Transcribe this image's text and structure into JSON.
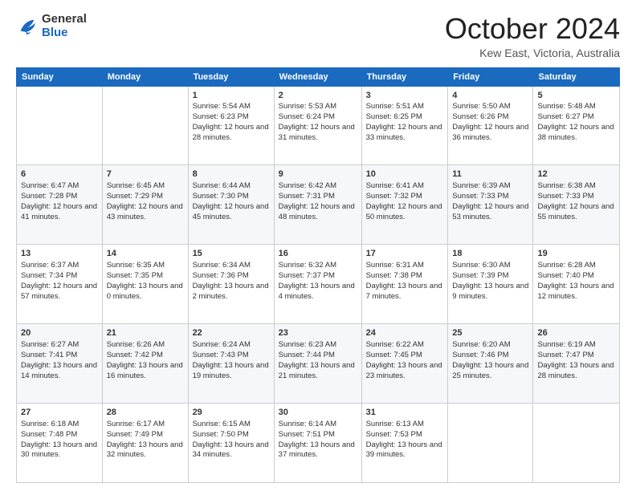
{
  "logo": {
    "general": "General",
    "blue": "Blue"
  },
  "header": {
    "month_year": "October 2024",
    "location": "Kew East, Victoria, Australia"
  },
  "days_of_week": [
    "Sunday",
    "Monday",
    "Tuesday",
    "Wednesday",
    "Thursday",
    "Friday",
    "Saturday"
  ],
  "weeks": [
    [
      {
        "day": "",
        "info": ""
      },
      {
        "day": "",
        "info": ""
      },
      {
        "day": "1",
        "info": "Sunrise: 5:54 AM\nSunset: 6:23 PM\nDaylight: 12 hours and 28 minutes."
      },
      {
        "day": "2",
        "info": "Sunrise: 5:53 AM\nSunset: 6:24 PM\nDaylight: 12 hours and 31 minutes."
      },
      {
        "day": "3",
        "info": "Sunrise: 5:51 AM\nSunset: 6:25 PM\nDaylight: 12 hours and 33 minutes."
      },
      {
        "day": "4",
        "info": "Sunrise: 5:50 AM\nSunset: 6:26 PM\nDaylight: 12 hours and 36 minutes."
      },
      {
        "day": "5",
        "info": "Sunrise: 5:48 AM\nSunset: 6:27 PM\nDaylight: 12 hours and 38 minutes."
      }
    ],
    [
      {
        "day": "6",
        "info": "Sunrise: 6:47 AM\nSunset: 7:28 PM\nDaylight: 12 hours and 41 minutes."
      },
      {
        "day": "7",
        "info": "Sunrise: 6:45 AM\nSunset: 7:29 PM\nDaylight: 12 hours and 43 minutes."
      },
      {
        "day": "8",
        "info": "Sunrise: 6:44 AM\nSunset: 7:30 PM\nDaylight: 12 hours and 45 minutes."
      },
      {
        "day": "9",
        "info": "Sunrise: 6:42 AM\nSunset: 7:31 PM\nDaylight: 12 hours and 48 minutes."
      },
      {
        "day": "10",
        "info": "Sunrise: 6:41 AM\nSunset: 7:32 PM\nDaylight: 12 hours and 50 minutes."
      },
      {
        "day": "11",
        "info": "Sunrise: 6:39 AM\nSunset: 7:33 PM\nDaylight: 12 hours and 53 minutes."
      },
      {
        "day": "12",
        "info": "Sunrise: 6:38 AM\nSunset: 7:33 PM\nDaylight: 12 hours and 55 minutes."
      }
    ],
    [
      {
        "day": "13",
        "info": "Sunrise: 6:37 AM\nSunset: 7:34 PM\nDaylight: 12 hours and 57 minutes."
      },
      {
        "day": "14",
        "info": "Sunrise: 6:35 AM\nSunset: 7:35 PM\nDaylight: 13 hours and 0 minutes."
      },
      {
        "day": "15",
        "info": "Sunrise: 6:34 AM\nSunset: 7:36 PM\nDaylight: 13 hours and 2 minutes."
      },
      {
        "day": "16",
        "info": "Sunrise: 6:32 AM\nSunset: 7:37 PM\nDaylight: 13 hours and 4 minutes."
      },
      {
        "day": "17",
        "info": "Sunrise: 6:31 AM\nSunset: 7:38 PM\nDaylight: 13 hours and 7 minutes."
      },
      {
        "day": "18",
        "info": "Sunrise: 6:30 AM\nSunset: 7:39 PM\nDaylight: 13 hours and 9 minutes."
      },
      {
        "day": "19",
        "info": "Sunrise: 6:28 AM\nSunset: 7:40 PM\nDaylight: 13 hours and 12 minutes."
      }
    ],
    [
      {
        "day": "20",
        "info": "Sunrise: 6:27 AM\nSunset: 7:41 PM\nDaylight: 13 hours and 14 minutes."
      },
      {
        "day": "21",
        "info": "Sunrise: 6:26 AM\nSunset: 7:42 PM\nDaylight: 13 hours and 16 minutes."
      },
      {
        "day": "22",
        "info": "Sunrise: 6:24 AM\nSunset: 7:43 PM\nDaylight: 13 hours and 19 minutes."
      },
      {
        "day": "23",
        "info": "Sunrise: 6:23 AM\nSunset: 7:44 PM\nDaylight: 13 hours and 21 minutes."
      },
      {
        "day": "24",
        "info": "Sunrise: 6:22 AM\nSunset: 7:45 PM\nDaylight: 13 hours and 23 minutes."
      },
      {
        "day": "25",
        "info": "Sunrise: 6:20 AM\nSunset: 7:46 PM\nDaylight: 13 hours and 25 minutes."
      },
      {
        "day": "26",
        "info": "Sunrise: 6:19 AM\nSunset: 7:47 PM\nDaylight: 13 hours and 28 minutes."
      }
    ],
    [
      {
        "day": "27",
        "info": "Sunrise: 6:18 AM\nSunset: 7:48 PM\nDaylight: 13 hours and 30 minutes."
      },
      {
        "day": "28",
        "info": "Sunrise: 6:17 AM\nSunset: 7:49 PM\nDaylight: 13 hours and 32 minutes."
      },
      {
        "day": "29",
        "info": "Sunrise: 6:15 AM\nSunset: 7:50 PM\nDaylight: 13 hours and 34 minutes."
      },
      {
        "day": "30",
        "info": "Sunrise: 6:14 AM\nSunset: 7:51 PM\nDaylight: 13 hours and 37 minutes."
      },
      {
        "day": "31",
        "info": "Sunrise: 6:13 AM\nSunset: 7:53 PM\nDaylight: 13 hours and 39 minutes."
      },
      {
        "day": "",
        "info": ""
      },
      {
        "day": "",
        "info": ""
      }
    ]
  ]
}
